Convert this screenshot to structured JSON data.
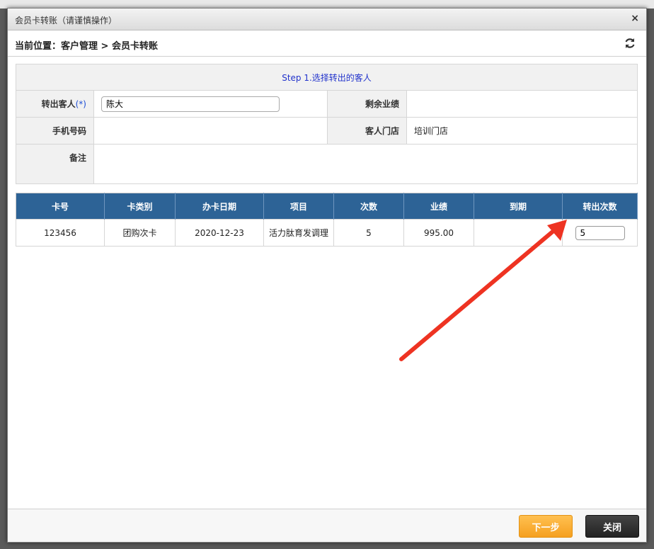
{
  "dialog": {
    "title": "会员卡转账（请谨慎操作）",
    "close_glyph": "×",
    "location": "当前位置：客户管理 > 会员卡转账"
  },
  "form": {
    "step": "Step 1.选择转出的客人",
    "out_customer_label": "转出客人",
    "required_mark": "(*)",
    "out_customer_value": "陈大",
    "remaining_perf_label": "剩余业绩",
    "remaining_perf_value": "",
    "phone_label": "手机号码",
    "phone_value": "",
    "store_label": "客人门店",
    "store_value": "培训门店",
    "remark_label": "备注",
    "remark_value": ""
  },
  "table": {
    "headers": [
      "卡号",
      "卡类别",
      "办卡日期",
      "项目",
      "次数",
      "业绩",
      "到期",
      "转出次数"
    ],
    "rows": [
      {
        "card_no": "123456",
        "card_type": "团购次卡",
        "date": "2020-12-23",
        "item": "活力肽育发调理",
        "count": "5",
        "performance": "995.00",
        "expire": "",
        "transfer_count": "5"
      }
    ]
  },
  "footer": {
    "next_label": "下一步",
    "close_label": "关闭"
  },
  "colors": {
    "header_blue": "#2d6396",
    "next_orange": "#f5a020",
    "annotation_red": "#ee3322"
  },
  "icons": [
    "close-icon",
    "refresh-icon",
    "annotation-arrow"
  ]
}
